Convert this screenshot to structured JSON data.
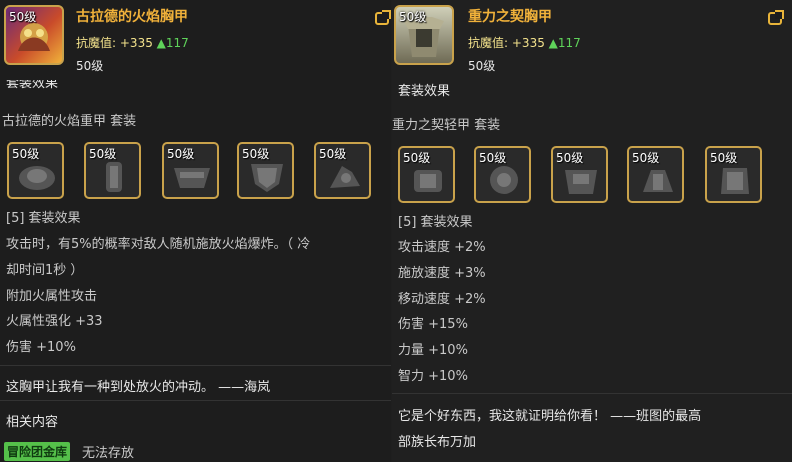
{
  "left": {
    "level_badge": "50级",
    "title": "古拉德的火焰胸甲",
    "stat_label": "抗魔值:",
    "stat_value": "+335",
    "stat_up": "▲117",
    "level_text": "50级",
    "section_title": "套装效果",
    "set_name": "古拉德的火焰重甲 套装",
    "slots": [
      "50级",
      "50级",
      "50级",
      "50级",
      "50级"
    ],
    "effect_header": "[5] 套装效果",
    "effects": [
      "攻击时，有5%的概率对敌人随机施放火焰爆炸。（ 冷",
      "却时间1秒 ）",
      "附加火属性攻击",
      "火属性强化 +33",
      "伤害 +10%"
    ],
    "quote": "这胸甲让我有一种到处放火的冲动。 ——海岚",
    "related_label": "相关内容",
    "storage_badge": "冒险团金库",
    "storage_status": "无法存放"
  },
  "right": {
    "level_badge": "50级",
    "title": "重力之契胸甲",
    "stat_label": "抗魔值:",
    "stat_value": "+335",
    "stat_up": "▲117",
    "level_text": "50级",
    "section_title": "套装效果",
    "set_name": "重力之契轻甲 套装",
    "slots": [
      "50级",
      "50级",
      "50级",
      "50级",
      "50级"
    ],
    "effect_header": "[5] 套装效果",
    "effects": [
      "攻击速度 +2%",
      "施放速度 +3%",
      "移动速度 +2%",
      "伤害 +15%",
      "力量 +10%",
      "智力 +10%"
    ],
    "quote_lines": [
      "它是个好东西，我这就证明给你看！ ——班图的最高",
      "部族长布万加"
    ]
  },
  "colors": {
    "title": "#f0b13a",
    "frame": "#c9a24b",
    "stat_up": "#5fd35a",
    "badge": "#55c04a"
  },
  "icons": [
    "share-icon",
    "fire-chest-armor-icon",
    "gravity-chest-armor-icon"
  ]
}
